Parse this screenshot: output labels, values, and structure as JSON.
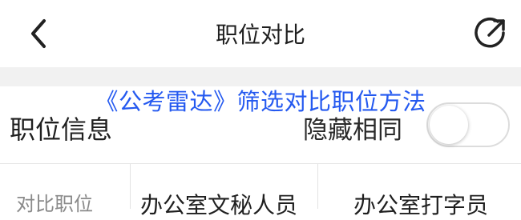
{
  "header": {
    "back_icon": "chevron-left-icon",
    "title": "职位对比",
    "share_icon": "share-arrow-icon"
  },
  "overlay": {
    "caption": "《公考雷达》筛选对比职位方法",
    "color": "#2459f0"
  },
  "info_bar": {
    "section_label": "职位信息",
    "toggle_label": "隐藏相同",
    "toggle_state": false
  },
  "table": {
    "row_label": "对比职位",
    "positions": [
      "办公室文秘人员",
      "办公室打字员"
    ]
  }
}
